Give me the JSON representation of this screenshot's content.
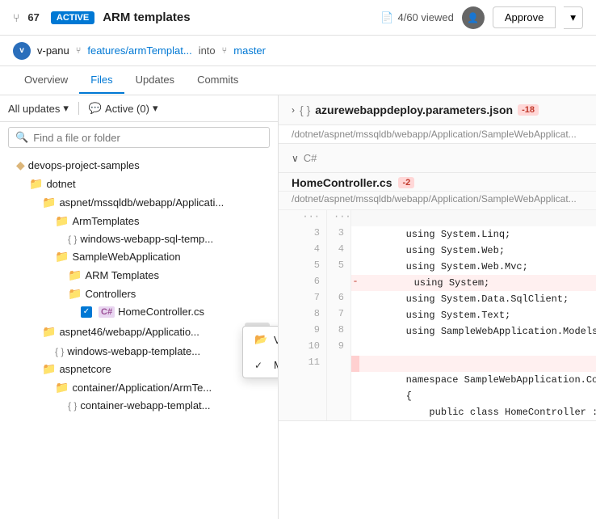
{
  "header": {
    "pr_icon": "⑂",
    "pr_number": "67",
    "active_badge": "ACTIVE",
    "pr_title": "ARM templates",
    "viewed": "4/60 viewed",
    "approve_label": "Approve",
    "dropdown_icon": "▾"
  },
  "second_bar": {
    "avatar_initials": "v",
    "author": "v-panu",
    "branch_from": "features/armTemplat...",
    "into": "into",
    "branch_to": "master"
  },
  "nav": {
    "tabs": [
      {
        "label": "Overview",
        "active": false
      },
      {
        "label": "Files",
        "active": true
      },
      {
        "label": "Updates",
        "active": false
      },
      {
        "label": "Commits",
        "active": false
      }
    ]
  },
  "filters": {
    "all_updates": "All updates",
    "active_label": "Active (0)"
  },
  "search": {
    "placeholder": "Find a file or folder"
  },
  "tree": {
    "root": "devops-project-samples",
    "items": [
      {
        "indent": 2,
        "type": "folder",
        "label": "dotnet"
      },
      {
        "indent": 3,
        "type": "folder",
        "label": "aspnet/mssqldb/webapp/Applicati...",
        "checked": false
      },
      {
        "indent": 4,
        "type": "folder",
        "label": "ArmTemplates"
      },
      {
        "indent": 5,
        "type": "braces",
        "label": "windows-webapp-sql-temp..."
      },
      {
        "indent": 4,
        "type": "folder",
        "label": "SampleWebApplication"
      },
      {
        "indent": 5,
        "type": "folder",
        "label": "ARM Templates"
      },
      {
        "indent": 5,
        "type": "folder",
        "label": "Controllers"
      },
      {
        "indent": 6,
        "type": "cs",
        "label": "HomeController.cs",
        "checked": true
      },
      {
        "indent": 3,
        "type": "folder",
        "label": "aspnet46/webapp/Applicatio...",
        "has_dots": true
      },
      {
        "indent": 4,
        "type": "braces",
        "label": "windows-webapp-template..."
      },
      {
        "indent": 3,
        "type": "folder",
        "label": "aspnetcore"
      },
      {
        "indent": 4,
        "type": "folder",
        "label": "container/Application/ArmTe..."
      },
      {
        "indent": 5,
        "type": "braces",
        "label": "container-webapp-templat..."
      }
    ]
  },
  "context_menu": {
    "items": [
      {
        "icon": "folder",
        "label": "View in file explorer",
        "checked": false
      },
      {
        "icon": "check",
        "label": "Mark as reviewed",
        "checked": true
      }
    ]
  },
  "files": [
    {
      "collapsed": true,
      "name": "azurewebappdeploy.parameters.json",
      "diff": "-18",
      "path": "/dotnet/aspnet/mssqldb/webapp/Application/SampleWebApplicat...",
      "type": "json",
      "expand_icon": "›"
    },
    {
      "collapsed": false,
      "name": "HomeController.cs",
      "diff": "-2",
      "path": "/dotnet/aspnet/mssqldb/webapp/Application/SampleWebApplicat...",
      "type": "cs",
      "expand_icon": "∨",
      "code": [
        {
          "old": "...",
          "new": "...",
          "type": "dots"
        },
        {
          "old": "3",
          "new": "3",
          "content": "        using System.Linq;",
          "type": "context"
        },
        {
          "old": "4",
          "new": "4",
          "content": "        using System.Web;",
          "type": "context"
        },
        {
          "old": "5",
          "new": "5",
          "content": "        using System.Web.Mvc;",
          "type": "context"
        },
        {
          "old": "6",
          "new": "",
          "content": "        using System;",
          "type": "deleted"
        },
        {
          "old": "7",
          "new": "6",
          "content": "        using System.Data.SqlClient;",
          "type": "context"
        },
        {
          "old": "8",
          "new": "7",
          "content": "        using System.Text;",
          "type": "context"
        },
        {
          "old": "9",
          "new": "8",
          "content": "        using SampleWebApplication.Models;",
          "type": "context"
        },
        {
          "old": "10",
          "new": "9",
          "content": "",
          "type": "context"
        },
        {
          "old": "11",
          "new": "",
          "content": "",
          "type": "deleted-marker"
        },
        {
          "old": "",
          "new": "",
          "content": "        namespace SampleWebApplication.Contro...",
          "type": "context"
        },
        {
          "old": "",
          "new": "",
          "content": "        {",
          "type": "context"
        },
        {
          "old": "",
          "new": "",
          "content": "            public class HomeController : Co...",
          "type": "context"
        }
      ]
    }
  ]
}
